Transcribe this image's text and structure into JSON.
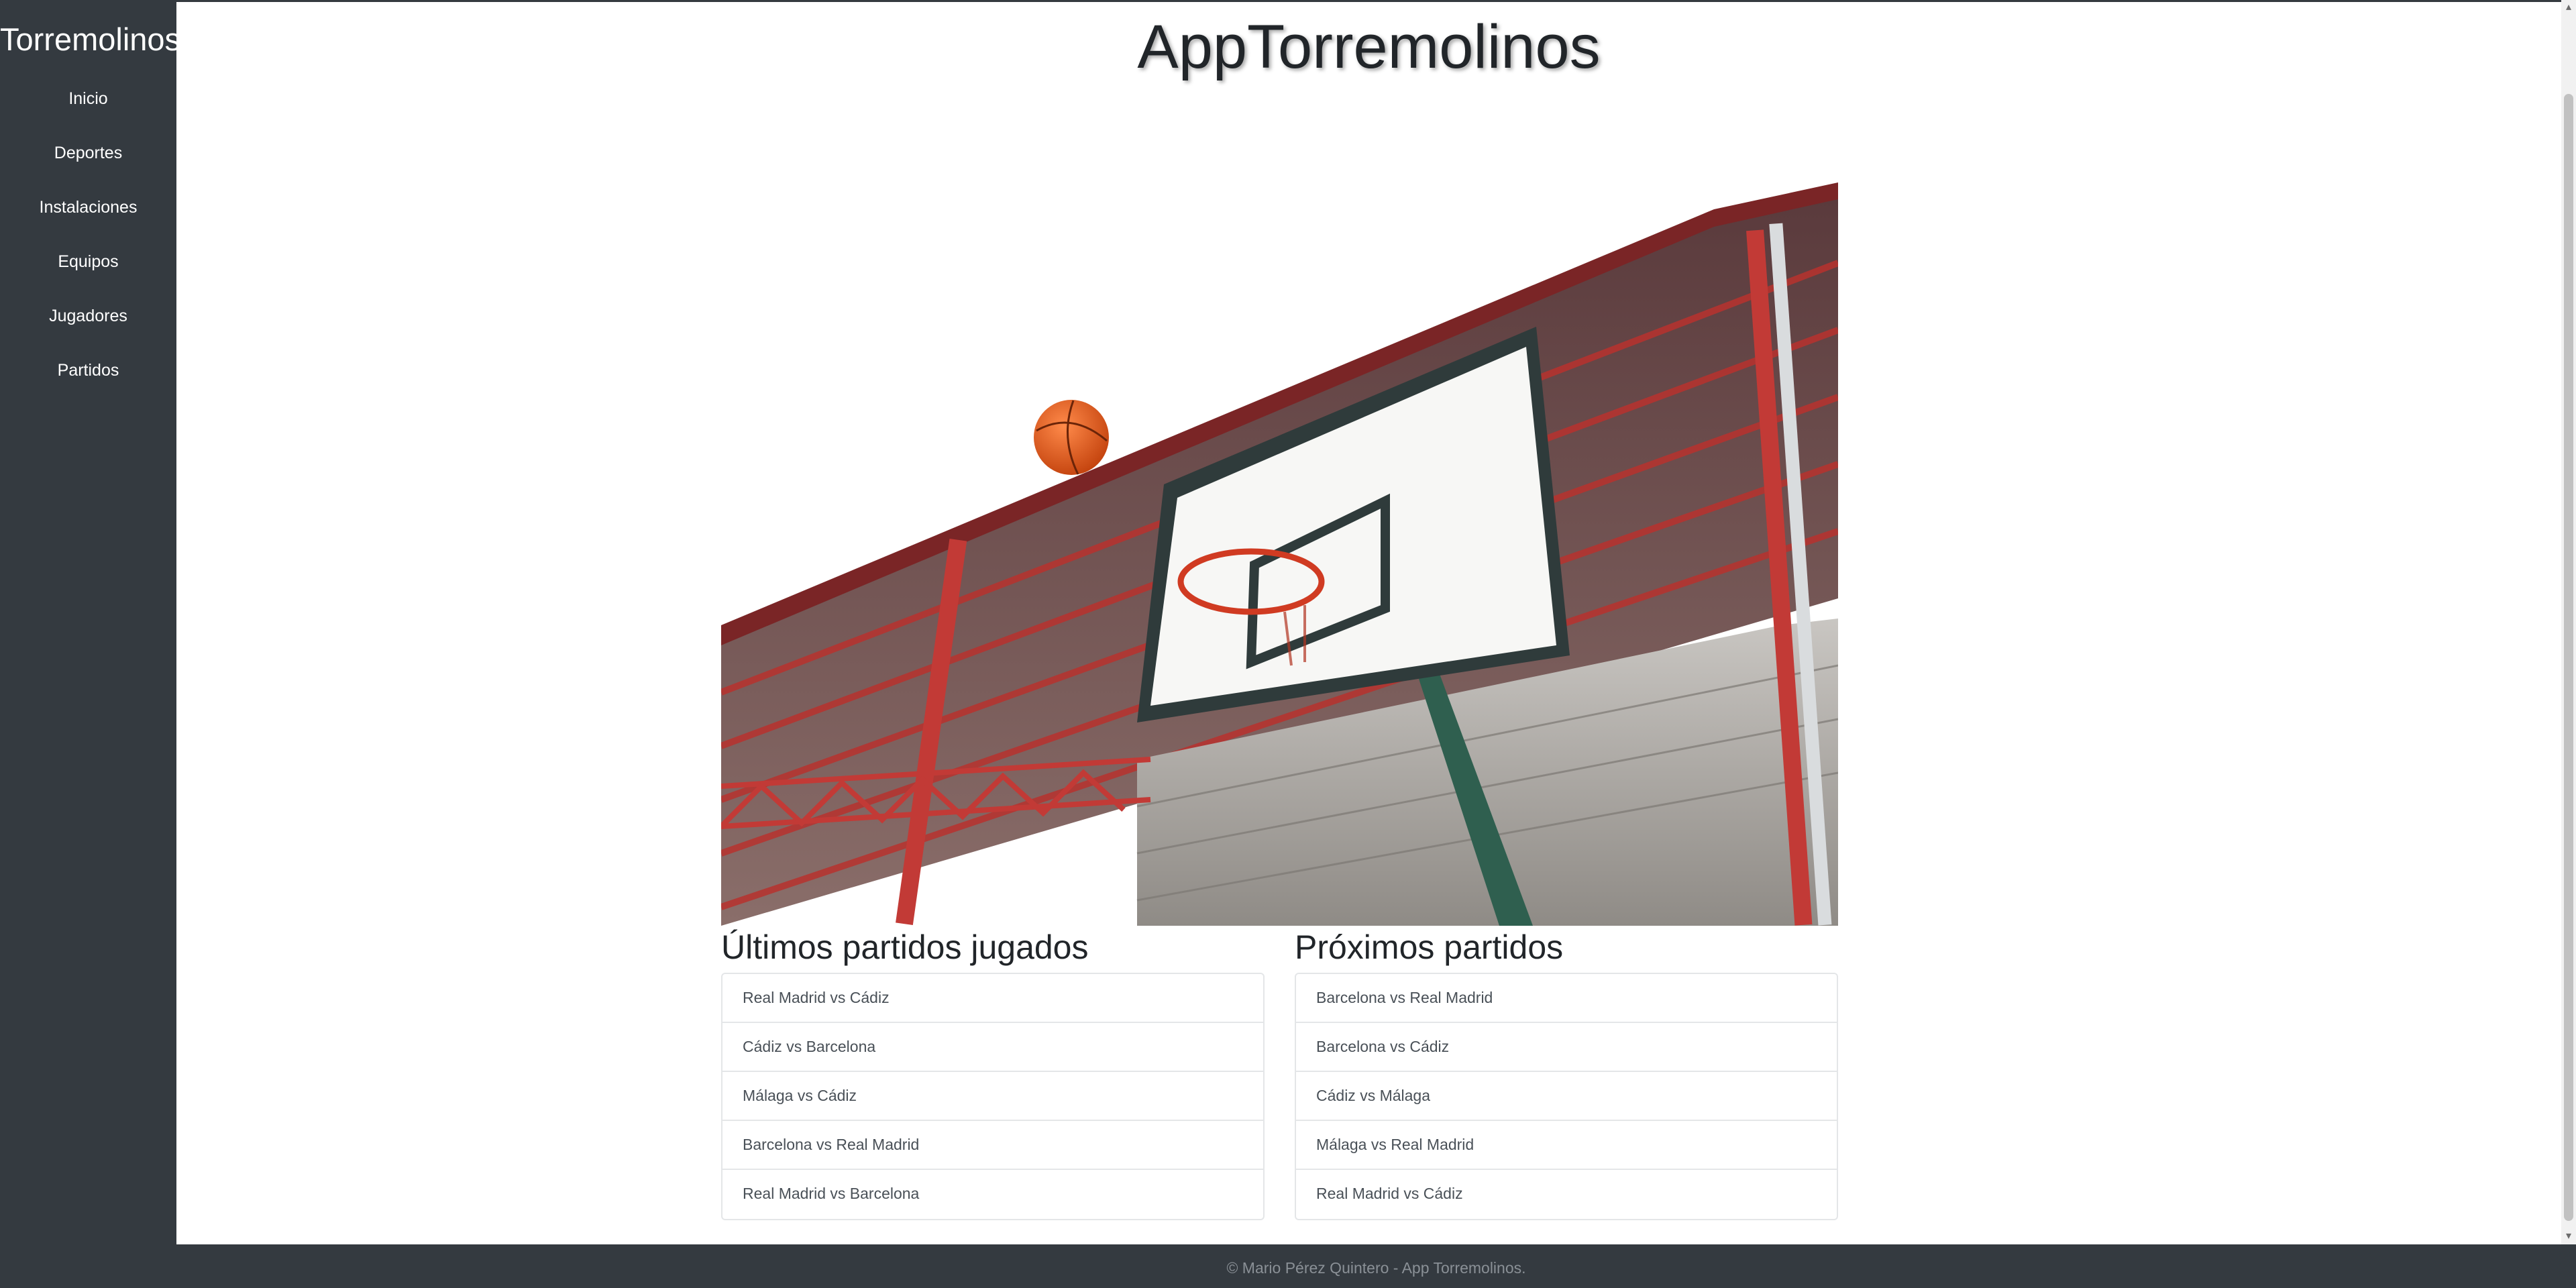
{
  "sidebar": {
    "brand": "Torremolinos",
    "items": [
      {
        "label": "Inicio"
      },
      {
        "label": "Deportes"
      },
      {
        "label": "Instalaciones"
      },
      {
        "label": "Equipos"
      },
      {
        "label": "Jugadores"
      },
      {
        "label": "Partidos"
      }
    ]
  },
  "header": {
    "title": "AppTorremolinos"
  },
  "hero": {
    "icon": "basketball-hoop-photo"
  },
  "past_matches": {
    "title": "Últimos partidos jugados",
    "items": [
      "Real Madrid vs Cádiz",
      "Cádiz vs Barcelona",
      "Málaga vs Cádiz",
      "Barcelona vs Real Madrid",
      "Real Madrid vs Barcelona"
    ]
  },
  "upcoming_matches": {
    "title": "Próximos partidos",
    "items": [
      "Barcelona vs Real Madrid",
      "Barcelona vs Cádiz",
      "Cádiz vs Málaga",
      "Málaga vs Real Madrid",
      "Real Madrid vs Cádiz"
    ]
  },
  "footer": {
    "text": "© Mario Pérez Quintero - App Torremolinos."
  },
  "colors": {
    "sidebar_bg": "#343a40",
    "footer_text": "#8a9096",
    "list_border": "#e4e6e8"
  }
}
